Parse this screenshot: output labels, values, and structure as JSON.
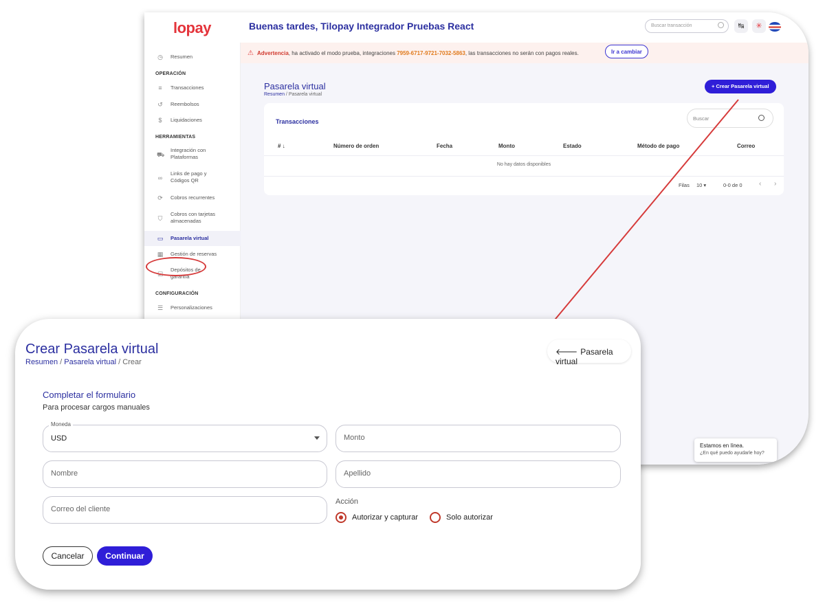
{
  "header": {
    "logo": "lopay",
    "greeting": "Buenas tardes, Tilopay Integrador Pruebas React",
    "search_placeholder": "Buscar transacción",
    "exchange_icon": "↹",
    "spark_icon": "✳"
  },
  "warning": {
    "label": "Advertencia",
    "text1": ", ha activado el modo prueba, integraciones ",
    "code": "7959-6717-9721-7032-5863",
    "text2": ", las transacciones no serán con pagos reales.",
    "button": "Ir a cambiar"
  },
  "sidebar": {
    "resumen": "Resumen",
    "section_operacion": "OPERACIÓN",
    "transacciones": "Transacciones",
    "reembolsos": "Reembolsos",
    "liquidaciones": "Liquidaciones",
    "section_herramientas": "HERRAMIENTAS",
    "integracion_1": "Integración con",
    "integracion_2": "Plataformas",
    "links_1": "Links de pago y",
    "links_2": "Códigos QR",
    "cobros_recurrentes": "Cobros recurrentes",
    "cobros_tarjetas_1": "Cobros con tarjetas",
    "cobros_tarjetas_2": "almacenadas",
    "pasarela": "Pasarela virtual",
    "reservas": "Gestión de reservas",
    "depositos_1": "Depósitos de",
    "depositos_2": "garantía",
    "section_config": "CONFIGURACIÓN",
    "personalizaciones": "Personalizaciones"
  },
  "list_page": {
    "title": "Pasarela virtual",
    "breadcrumb_home": "Resumen",
    "breadcrumb_sep": " / ",
    "breadcrumb_current": "Pasarela virtual",
    "create_button": "+ Crear Pasarela virtual",
    "card_title": "Transacciones",
    "search_placeholder": "Buscar",
    "columns": [
      "# ↓",
      "Número de orden",
      "Fecha",
      "Monto",
      "Estado",
      "Método de pago",
      "Correo"
    ],
    "no_data": "No hay datos disponibles",
    "rows_label": "Filas",
    "rows_value": "10 ▾",
    "range": "0-0 de 0",
    "prev": "‹",
    "next": "›"
  },
  "chat": {
    "line1": "Estamos en línea.",
    "line2": "¿En qué puedo ayudarle hoy?"
  },
  "form_page": {
    "title": "Crear Pasarela virtual",
    "breadcrumb_home": "Resumen",
    "breadcrumb_sep1": " / ",
    "breadcrumb_mid": "Pasarela virtual",
    "breadcrumb_sep2": " / ",
    "breadcrumb_current": "Crear",
    "back_button": "Pasarela virtual",
    "heading": "Completar el formulario",
    "subheading": "Para procesar cargos manuales",
    "moneda_label": "Moneda",
    "moneda_value": "USD",
    "monto_placeholder": "Monto",
    "nombre_placeholder": "Nombre",
    "apellido_placeholder": "Apellido",
    "correo_placeholder": "Correo del cliente",
    "accion_label": "Acción",
    "radio_option1": "Autorizar y capturar",
    "radio_option2": "Solo autorizar",
    "cancel_button": "Cancelar",
    "continue_button": "Continuar"
  },
  "colors": {
    "brand": "#2f1ed8",
    "title": "#2b2fa0",
    "accent_red": "#d63b3b"
  }
}
